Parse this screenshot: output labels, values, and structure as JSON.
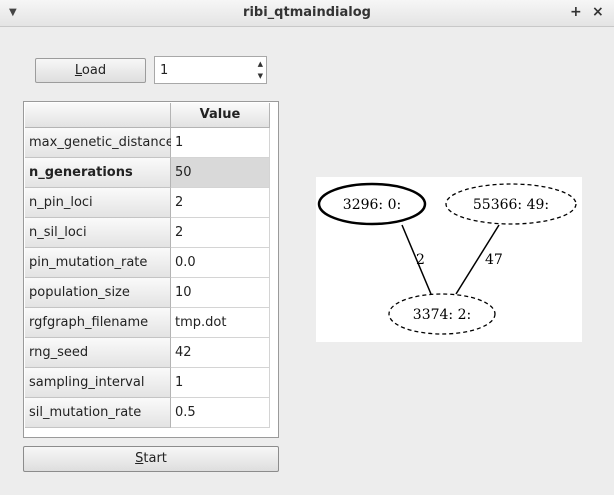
{
  "window": {
    "title": "ribi_qtmaindialog",
    "menu_icon": "chevron-down-icon",
    "maximize_icon": "plus-icon",
    "close_icon": "close-icon"
  },
  "load_button": {
    "label_first": "L",
    "label_rest": "oad"
  },
  "spinbox": {
    "value": "1"
  },
  "table": {
    "column_header": "Value",
    "rows": [
      {
        "name": "max_genetic_distance",
        "value": "1"
      },
      {
        "name": "n_generations",
        "value": "50"
      },
      {
        "name": "n_pin_loci",
        "value": "2"
      },
      {
        "name": "n_sil_loci",
        "value": "2"
      },
      {
        "name": "pin_mutation_rate",
        "value": "0.0"
      },
      {
        "name": "population_size",
        "value": "10"
      },
      {
        "name": "rgfgraph_filename",
        "value": "tmp.dot"
      },
      {
        "name": "rng_seed",
        "value": "42"
      },
      {
        "name": "sampling_interval",
        "value": "1"
      },
      {
        "name": "sil_mutation_rate",
        "value": "0.5"
      }
    ],
    "selected_row": 1
  },
  "start_button": {
    "label_first": "S",
    "label_rest": "tart"
  },
  "graph": {
    "nodes": [
      {
        "id": "a",
        "label": "3296: 0:",
        "style": "bold"
      },
      {
        "id": "b",
        "label": "55366: 49:",
        "style": "dashed"
      },
      {
        "id": "c",
        "label": "3374: 2:",
        "style": "dashed"
      }
    ],
    "edges": [
      {
        "from": "a",
        "to": "c",
        "label": "2"
      },
      {
        "from": "b",
        "to": "c",
        "label": "47"
      }
    ]
  }
}
